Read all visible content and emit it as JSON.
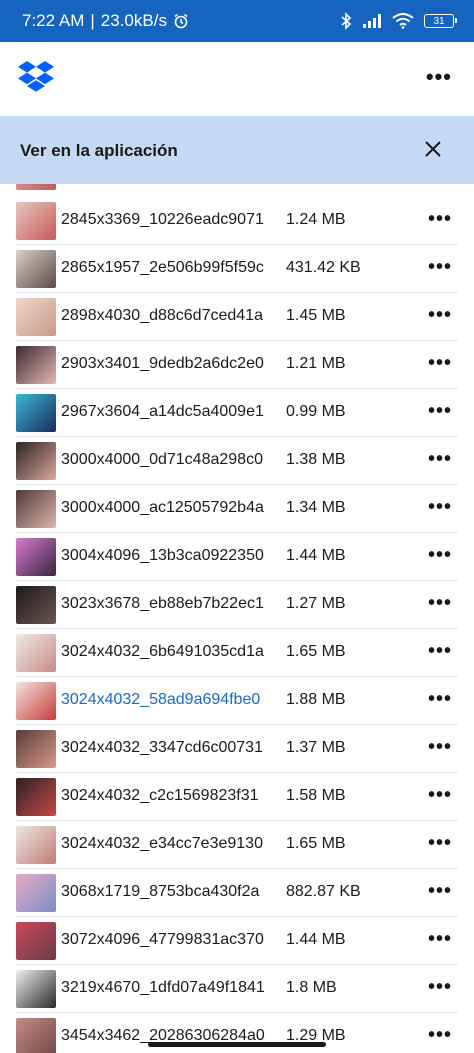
{
  "status_bar": {
    "time": "7:22 AM",
    "separator": "|",
    "net_speed": "23.0kB/s",
    "battery": "31",
    "icons": [
      "alarm-icon",
      "bluetooth-icon",
      "signal-icon",
      "wifi-icon",
      "battery-icon"
    ]
  },
  "app_bar": {
    "logo": "dropbox-logo",
    "more": "•••"
  },
  "banner": {
    "text": "Ver en la aplicación",
    "close_icon": "close-icon"
  },
  "colors": {
    "status_bar_bg": "#1565c0",
    "banner_bg": "#c5d9f5",
    "selected_text": "#1b68c9",
    "dropbox_blue": "#0061fe"
  },
  "files": [
    {
      "name": "2845x3369_10226eadc9071",
      "size": "1.24 MB",
      "more": "•••",
      "selected": false,
      "thumb": [
        "#e8c6c0",
        "#c95a5a"
      ]
    },
    {
      "name": "2865x1957_2e506b99f5f59c",
      "size": "431.42 KB",
      "more": "•••",
      "selected": false,
      "thumb": [
        "#d9cfc9",
        "#5c4b46"
      ]
    },
    {
      "name": "2898x4030_d88c6d7ced41a",
      "size": "1.45 MB",
      "more": "•••",
      "selected": false,
      "thumb": [
        "#f0d6cc",
        "#c79a86"
      ]
    },
    {
      "name": "2903x3401_9dedb2a6dc2e0",
      "size": "1.21 MB",
      "more": "•••",
      "selected": false,
      "thumb": [
        "#3a2a35",
        "#e6b8b0"
      ]
    },
    {
      "name": "2967x3604_a14dc5a4009e1",
      "size": "0.99 MB",
      "more": "•••",
      "selected": false,
      "thumb": [
        "#3bb7d8",
        "#1a2c5c"
      ]
    },
    {
      "name": "3000x4000_0d71c48a298c0",
      "size": "1.38 MB",
      "more": "•••",
      "selected": false,
      "thumb": [
        "#2b2323",
        "#d9a89a"
      ]
    },
    {
      "name": "3000x4000_ac12505792b4a",
      "size": "1.34 MB",
      "more": "•••",
      "selected": false,
      "thumb": [
        "#4a3a3a",
        "#e0b5aa"
      ]
    },
    {
      "name": "3004x4096_13b3ca0922350",
      "size": "1.44 MB",
      "more": "•••",
      "selected": false,
      "thumb": [
        "#d87ad0",
        "#3a2540"
      ]
    },
    {
      "name": "3023x3678_eb88eb7b22ec1",
      "size": "1.27 MB",
      "more": "•••",
      "selected": false,
      "thumb": [
        "#1e1a1a",
        "#6b5550"
      ]
    },
    {
      "name": "3024x4032_6b6491035cd1a",
      "size": "1.65 MB",
      "more": "•••",
      "selected": false,
      "thumb": [
        "#efe9e6",
        "#c78c86"
      ]
    },
    {
      "name": "3024x4032_58ad9a694fbe0",
      "size": "1.88 MB",
      "more": "•••",
      "selected": true,
      "thumb": [
        "#f2e6e0",
        "#c93a3a"
      ]
    },
    {
      "name": "3024x4032_3347cd6c00731",
      "size": "1.37 MB",
      "more": "•••",
      "selected": false,
      "thumb": [
        "#5a3a38",
        "#d69a8c"
      ]
    },
    {
      "name": "3024x4032_c2c1569823f31",
      "size": "1.58 MB",
      "more": "•••",
      "selected": false,
      "thumb": [
        "#2a2222",
        "#c84848"
      ]
    },
    {
      "name": "3024x4032_e34cc7e3e9130",
      "size": "1.65 MB",
      "more": "•••",
      "selected": false,
      "thumb": [
        "#ece6e4",
        "#c27c74"
      ]
    },
    {
      "name": "3068x1719_8753bca430f2a",
      "size": "882.87 KB",
      "more": "•••",
      "selected": false,
      "thumb": [
        "#e7a9c6",
        "#7a8fc4"
      ]
    },
    {
      "name": "3072x4096_47799831ac370",
      "size": "1.44 MB",
      "more": "•••",
      "selected": false,
      "thumb": [
        "#c94a5a",
        "#6b3a48"
      ]
    },
    {
      "name": "3219x4670_1dfd07a49f1841",
      "size": "1.8 MB",
      "more": "•••",
      "selected": false,
      "thumb": [
        "#efefef",
        "#2a2a2a"
      ]
    },
    {
      "name": "3454x3462_20286306284a0",
      "size": "1.29 MB",
      "more": "•••",
      "selected": false,
      "thumb": [
        "#c98a86",
        "#6e4a48"
      ]
    }
  ]
}
